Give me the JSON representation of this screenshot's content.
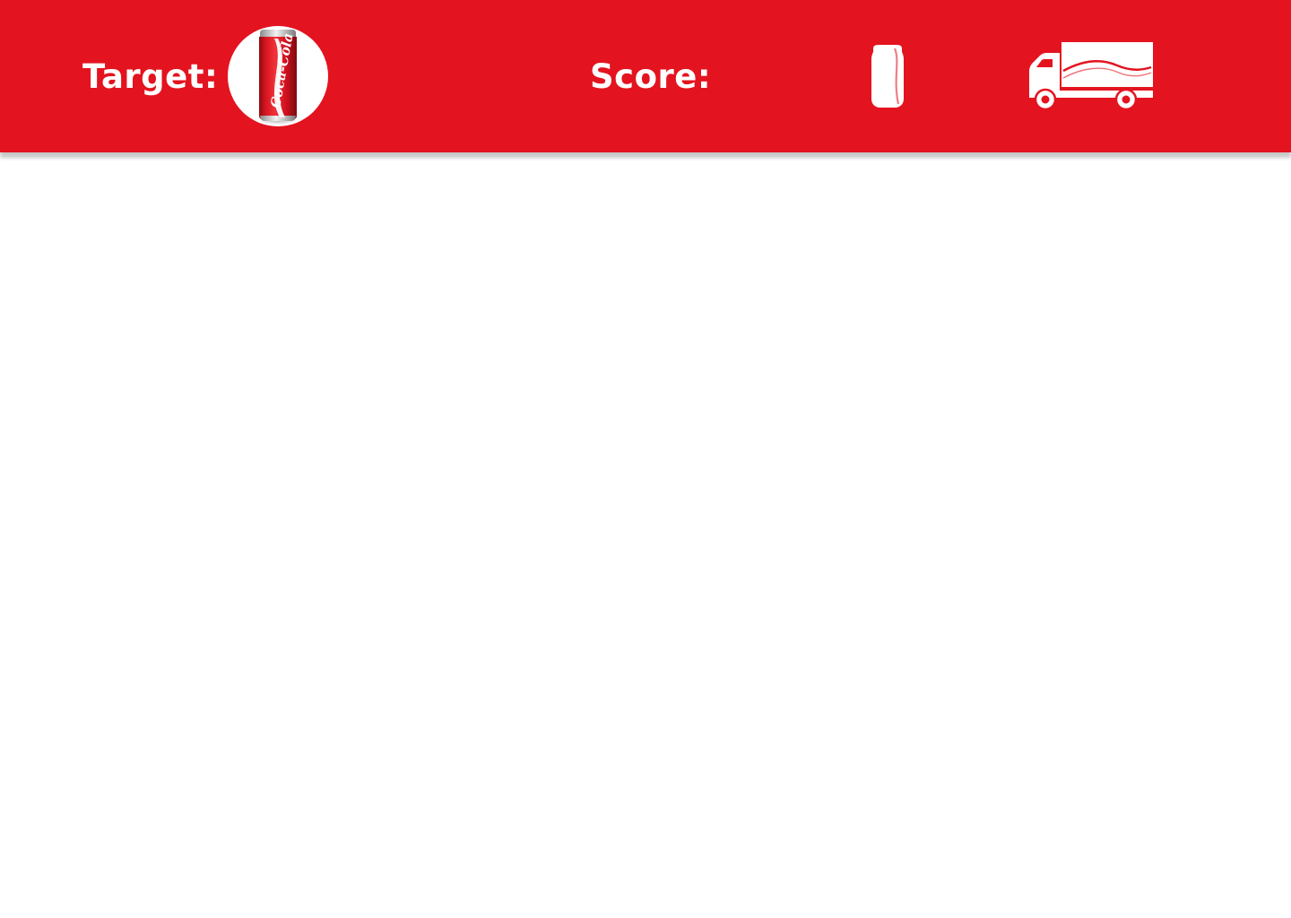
{
  "colors": {
    "brand_red": "#e3141f",
    "background": "#ffffff",
    "icon_white": "#ffffff"
  },
  "header": {
    "target_label": "Target:",
    "target_item_icon": "cola-can-icon",
    "score_label": "Score:",
    "score_icons": [
      "can-silhouette-icon",
      "delivery-truck-icon"
    ]
  },
  "target_can": {
    "brand_text": "Coca-Cola"
  }
}
